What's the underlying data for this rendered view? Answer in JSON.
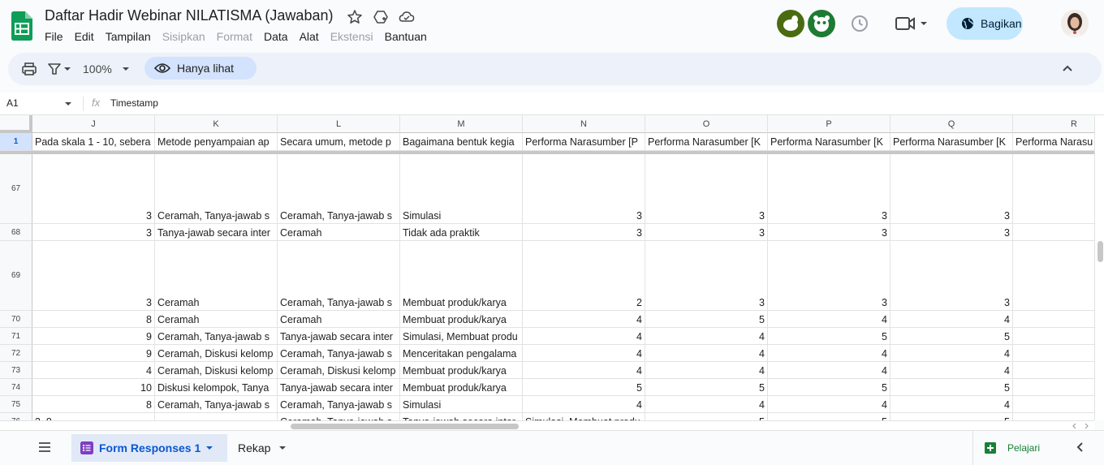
{
  "app": {
    "title": "Daftar Hadir Webinar NILATISMA (Jawaban)",
    "menu": [
      {
        "label": "File",
        "disabled": false
      },
      {
        "label": "Edit",
        "disabled": false
      },
      {
        "label": "Tampilan",
        "disabled": false
      },
      {
        "label": "Sisipkan",
        "disabled": true
      },
      {
        "label": "Format",
        "disabled": true
      },
      {
        "label": "Data",
        "disabled": false
      },
      {
        "label": "Alat",
        "disabled": false
      },
      {
        "label": "Ekstensi",
        "disabled": true
      },
      {
        "label": "Bantuan",
        "disabled": false
      }
    ],
    "share_label": "Bagikan"
  },
  "toolbar": {
    "zoom": "100%",
    "view_only_label": "Hanya lihat"
  },
  "formula_bar": {
    "cell_ref": "A1",
    "fx": "fx",
    "value": "Timestamp"
  },
  "grid": {
    "columns": [
      {
        "letter": "J",
        "header": "Pada skala 1 - 10, sebera"
      },
      {
        "letter": "K",
        "header": "Metode penyampaian ap"
      },
      {
        "letter": "L",
        "header": "Secara umum, metode p"
      },
      {
        "letter": "M",
        "header": "Bagaimana bentuk kegia"
      },
      {
        "letter": "N",
        "header": "Performa Narasumber [P"
      },
      {
        "letter": "O",
        "header": "Performa Narasumber [K"
      },
      {
        "letter": "P",
        "header": "Performa Narasumber [K"
      },
      {
        "letter": "Q",
        "header": "Performa Narasumber [K"
      },
      {
        "letter": "R",
        "header": "Performa Narasu"
      }
    ],
    "header_row_num": "1",
    "rows": [
      {
        "num": "67",
        "tall": true,
        "cells": [
          "3",
          "Ceramah, Tanya-jawab s",
          "Ceramah, Tanya-jawab s",
          "Simulasi",
          "3",
          "3",
          "3",
          "3",
          ""
        ]
      },
      {
        "num": "68",
        "tall": false,
        "cells": [
          "3",
          "Tanya-jawab secara inter",
          "Ceramah",
          "Tidak ada praktik",
          "3",
          "3",
          "3",
          "3",
          ""
        ]
      },
      {
        "num": "69",
        "tall": true,
        "cells": [
          "3",
          "Ceramah",
          "Ceramah, Tanya-jawab s",
          "Membuat produk/karya",
          "2",
          "3",
          "3",
          "3",
          ""
        ]
      },
      {
        "num": "70",
        "tall": false,
        "cells": [
          "8",
          "Ceramah",
          "Ceramah",
          "Membuat produk/karya",
          "4",
          "5",
          "4",
          "4",
          ""
        ]
      },
      {
        "num": "71",
        "tall": false,
        "cells": [
          "9",
          "Ceramah, Tanya-jawab s",
          "Tanya-jawab secara inter",
          "Simulasi, Membuat produ",
          "4",
          "4",
          "5",
          "5",
          ""
        ]
      },
      {
        "num": "72",
        "tall": false,
        "cells": [
          "9",
          "Ceramah, Diskusi kelomp",
          "Ceramah, Tanya-jawab s",
          "Menceritakan pengalama",
          "4",
          "4",
          "4",
          "4",
          ""
        ]
      },
      {
        "num": "73",
        "tall": false,
        "cells": [
          "4",
          "Ceramah, Diskusi kelomp",
          "Ceramah, Diskusi kelomp",
          "Membuat produk/karya",
          "4",
          "4",
          "4",
          "4",
          ""
        ]
      },
      {
        "num": "74",
        "tall": false,
        "cells": [
          "10",
          "Diskusi kelompok, Tanya",
          "Tanya-jawab secara inter",
          "Membuat produk/karya",
          "5",
          "5",
          "5",
          "5",
          ""
        ]
      },
      {
        "num": "75",
        "tall": false,
        "cells": [
          "8",
          "Ceramah, Tanya-jawab s",
          "Ceramah, Tanya-jawab s",
          "Simulasi",
          "4",
          "4",
          "4",
          "4",
          ""
        ]
      },
      {
        "num": "76",
        "tall": false,
        "cells": [
          "3, 8",
          "",
          "Ceramah, Tanya-jawab s",
          "Tanya-jawab secara inter",
          "Simulasi, Membuat produ",
          "5",
          "5",
          "5",
          "5"
        ]
      },
      {
        "num": "77",
        "tall": false,
        "cells": [
          "8",
          "Ceramah, Tanya-jawab s",
          "Ceramah, Tanya-jawab s",
          "Simulasi",
          "4",
          "4",
          "4",
          "4",
          ""
        ]
      }
    ]
  },
  "sheets": {
    "active": "Form Responses 1",
    "other": "Rekap",
    "explore_label": "Pelajari"
  },
  "colors": {
    "sheets_green": "#188038",
    "accent_blue": "#0b57d0",
    "share_bg": "#c2e7ff"
  }
}
